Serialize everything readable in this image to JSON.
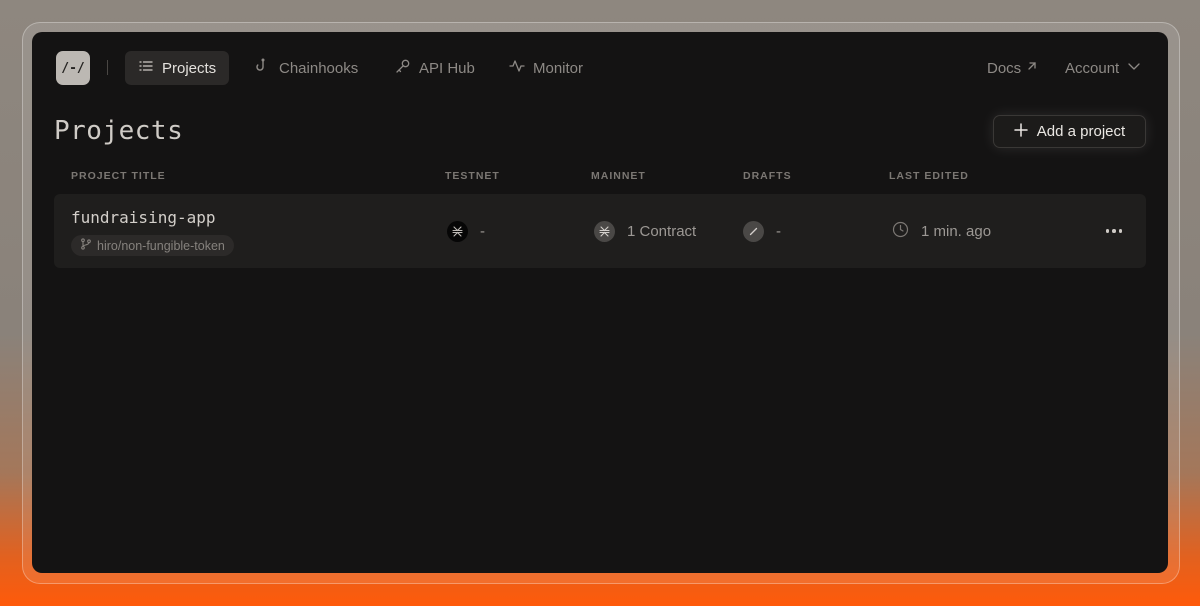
{
  "nav": {
    "logo": "/-/",
    "items": [
      {
        "label": "Projects",
        "icon": "list-icon",
        "active": true
      },
      {
        "label": "Chainhooks",
        "icon": "hook-icon",
        "active": false
      },
      {
        "label": "API Hub",
        "icon": "key-icon",
        "active": false
      },
      {
        "label": "Monitor",
        "icon": "activity-icon",
        "active": false
      }
    ],
    "docs": "Docs",
    "account": "Account"
  },
  "page": {
    "title": "Projects",
    "add_button": "Add a project"
  },
  "table": {
    "columns": [
      "PROJECT TITLE",
      "TESTNET",
      "MAINNET",
      "DRAFTS",
      "LAST EDITED"
    ],
    "rows": [
      {
        "title": "fundraising-app",
        "branch": "hiro/non-fungible-token",
        "testnet": "-",
        "mainnet": "1 Contract",
        "drafts": "-",
        "last_edited": "1 min. ago"
      }
    ]
  },
  "colors": {
    "background": "#141313",
    "row": "#1f1e1d",
    "accent_gradient": "#ff5a0a"
  }
}
